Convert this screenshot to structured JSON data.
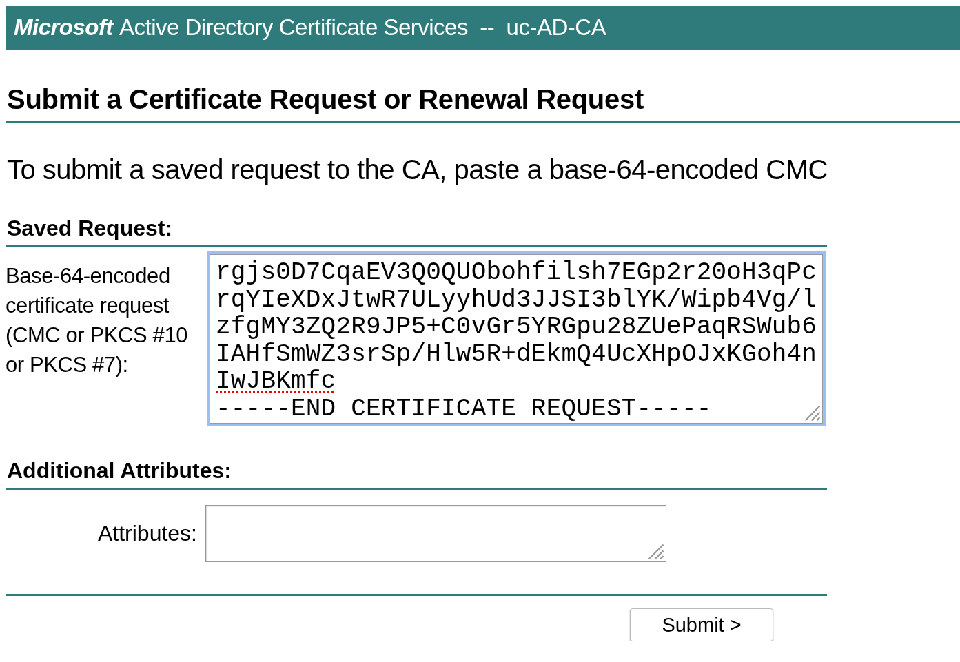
{
  "banner": {
    "brand": "Microsoft",
    "title": "Active Directory Certificate Services  --  uc-AD-CA"
  },
  "heading": "Submit a Certificate Request or Renewal Request",
  "intro": "To submit a saved request to the CA, paste a base-64-encoded CMC",
  "saved_request": {
    "section": "Saved Request:",
    "label": "Base-64-encoded certificate request (CMC or PKCS #10 or PKCS #7):",
    "lines": [
      {
        "text": "rgjs0D7CqaEV3Q0QUObohfilsh7EGp2r20oH3qPc",
        "misspelled": false
      },
      {
        "text": "rqYIeXDxJtwR7ULyyhUd3JJSI3blYK/Wipb4Vg/l",
        "misspelled": false
      },
      {
        "text": "zfgMY3ZQ2R9JP5+C0vGr5YRGpu28ZUePaqRSWub6",
        "misspelled": false
      },
      {
        "text": "IAHfSmWZ3srSp/Hlw5R+dEkmQ4UcXHpOJxKGoh4n",
        "misspelled": false
      },
      {
        "text": "IwJBKmfc",
        "misspelled": true
      },
      {
        "text": "-----END CERTIFICATE REQUEST-----",
        "misspelled": false
      }
    ],
    "focused": true
  },
  "additional_attributes": {
    "section": "Additional Attributes:",
    "label": "Attributes:"
  },
  "submit_button": "Submit >"
}
